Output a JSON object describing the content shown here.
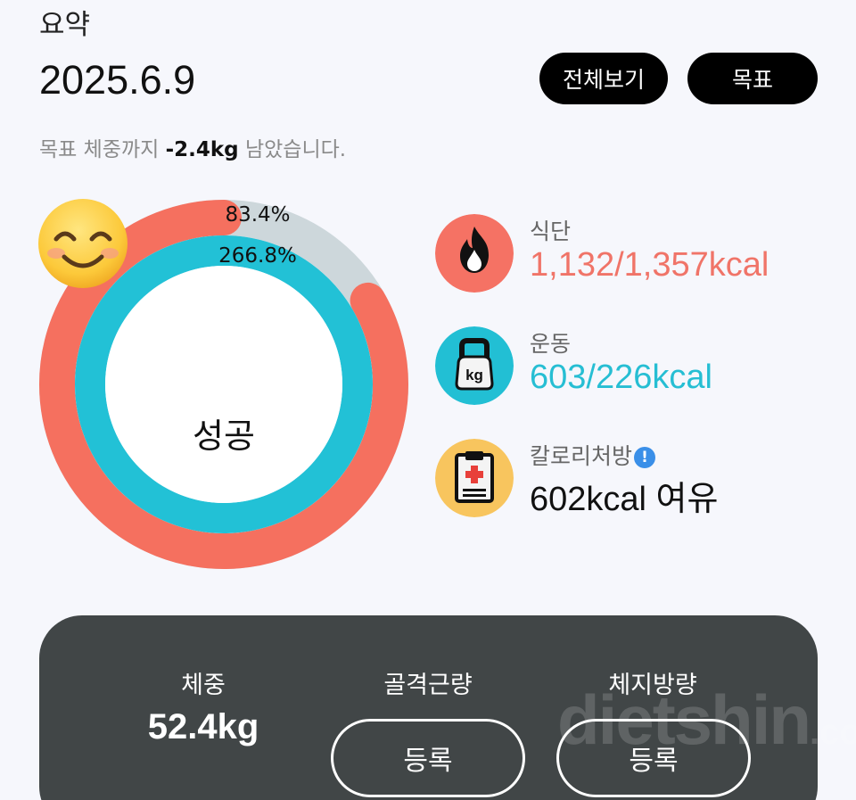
{
  "summary": {
    "title": "요약",
    "date": "2025.6.9",
    "buttons": {
      "view_all": "전체보기",
      "goal": "목표"
    },
    "remaining": {
      "prefix": "목표 체중까지 ",
      "value": "-2.4kg",
      "suffix": " 남았습니다."
    }
  },
  "ring": {
    "outer_percent_text": "83.4%",
    "inner_percent_text": "266.8%",
    "outer_progress": 0.834,
    "inner_progress": 1.0,
    "status_text": "성공",
    "colors": {
      "outer": "#f5705f",
      "outer_track": "#cdd7db",
      "inner": "#22c1d6"
    }
  },
  "metrics": {
    "diet": {
      "label": "식단",
      "value": "1,132/1,357kcal",
      "color": "#f07468",
      "icon": "fire-icon"
    },
    "exercise": {
      "label": "운동",
      "value": "603/226kcal",
      "color": "#26bed3",
      "icon": "kettlebell-icon",
      "icon_text": "kg"
    },
    "calorie_prescription": {
      "label": "칼로리처방",
      "info_symbol": "!",
      "value": "602kcal 여유",
      "color": "#111111",
      "icon": "clipboard-icon"
    }
  },
  "body_stats": {
    "weight": {
      "label": "체중",
      "value": "52.4kg"
    },
    "muscle": {
      "label": "골격근량",
      "button": "등록"
    },
    "fat": {
      "label": "체지방량",
      "button": "등록"
    }
  },
  "watermark": {
    "main": "dietshin",
    "suffix": ".com"
  }
}
